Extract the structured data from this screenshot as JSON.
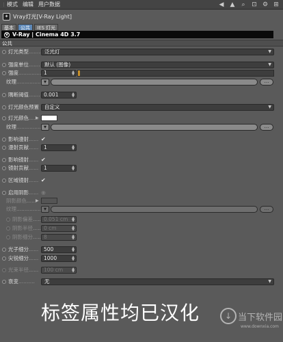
{
  "menubar": {
    "items": [
      "模式",
      "编辑",
      "用户数据"
    ]
  },
  "object": {
    "title": "Vray灯光[V-Ray Light]"
  },
  "tabs": [
    {
      "label": "基本",
      "active": false
    },
    {
      "label": "公共",
      "active": true
    },
    {
      "label": "IES 灯光",
      "active": false
    }
  ],
  "banner": {
    "text": "V-Ray | Cinema 4D   3.7"
  },
  "section": {
    "title": "公共"
  },
  "fields": {
    "light_type": {
      "label": "灯光类型",
      "value": "泛光灯"
    },
    "intensity_unit": {
      "label": "强度单位",
      "value": "默认 (图像)"
    },
    "intensity": {
      "label": "强度",
      "value": "1",
      "fill_fraction": 0.01
    },
    "intensity_texture": {
      "label": "纹理"
    },
    "cutoff": {
      "label": "隅断阈值",
      "value": "0.001"
    },
    "color_preset": {
      "label": "灯光颜色预置",
      "value": "自定义"
    },
    "light_color": {
      "label": "灯光颜色"
    },
    "color_texture": {
      "label": "纹理"
    },
    "affect_diffuse": {
      "label": "影响漫射"
    },
    "diffuse_contrib": {
      "label": "漫射贡献",
      "value": "1"
    },
    "affect_specular": {
      "label": "影响镜射"
    },
    "specular_contrib": {
      "label": "镜射贡献",
      "value": "1"
    },
    "area_specular": {
      "label": "区域镜射"
    },
    "enable_shadow": {
      "label": "启用阴影"
    },
    "shadow_color": {
      "label": "阴影颜色"
    },
    "shadow_texture": {
      "label": "纹理"
    },
    "shadow_bias": {
      "label": "阴影偏差",
      "value": "0.051 cm"
    },
    "shadow_radius": {
      "label": "阴影半径",
      "value": "0 cm"
    },
    "shadow_subdivs": {
      "label": "阴影细分",
      "value": "8"
    },
    "photon_subdivs": {
      "label": "光子细分",
      "value": "500"
    },
    "caustic_subdivs": {
      "label": "尖锐细分",
      "value": "1000"
    },
    "photon_radius": {
      "label": "光束半径",
      "value": "100 cm"
    },
    "decay": {
      "label": "衰变",
      "value": "无"
    }
  },
  "caption": "标签属性均已汉化",
  "watermark": {
    "brand": "当下软件园",
    "url": "www.downxia.com"
  },
  "icons": {
    "menu_arrow": "arrow-left-icon",
    "toolbar": [
      "arrow-back-icon",
      "arrow-up-icon",
      "search-icon",
      "lock-icon",
      "gear-icon",
      "plus-icon"
    ]
  }
}
